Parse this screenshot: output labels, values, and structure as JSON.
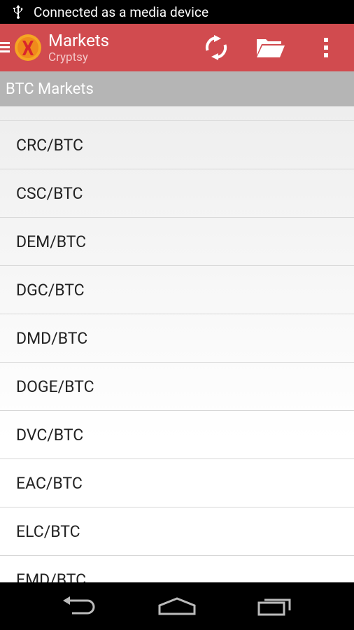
{
  "status_bar": {
    "text": "Connected as a media device",
    "icon": "usb-icon"
  },
  "action_bar": {
    "title": "Markets",
    "subtitle": "Cryptsy",
    "logo_icon": "cryptsy-logo",
    "actions": [
      "refresh-icon",
      "folder-icon",
      "overflow-menu-icon"
    ],
    "color": "#d14b4f"
  },
  "section": {
    "title": "BTC Markets"
  },
  "markets": [
    "CRC/BTC",
    "CSC/BTC",
    "DEM/BTC",
    "DGC/BTC",
    "DMD/BTC",
    "DOGE/BTC",
    "DVC/BTC",
    "EAC/BTC",
    "ELC/BTC",
    "EMD/BTC"
  ],
  "nav_bar": [
    "back-icon",
    "home-icon",
    "recent-apps-icon"
  ]
}
